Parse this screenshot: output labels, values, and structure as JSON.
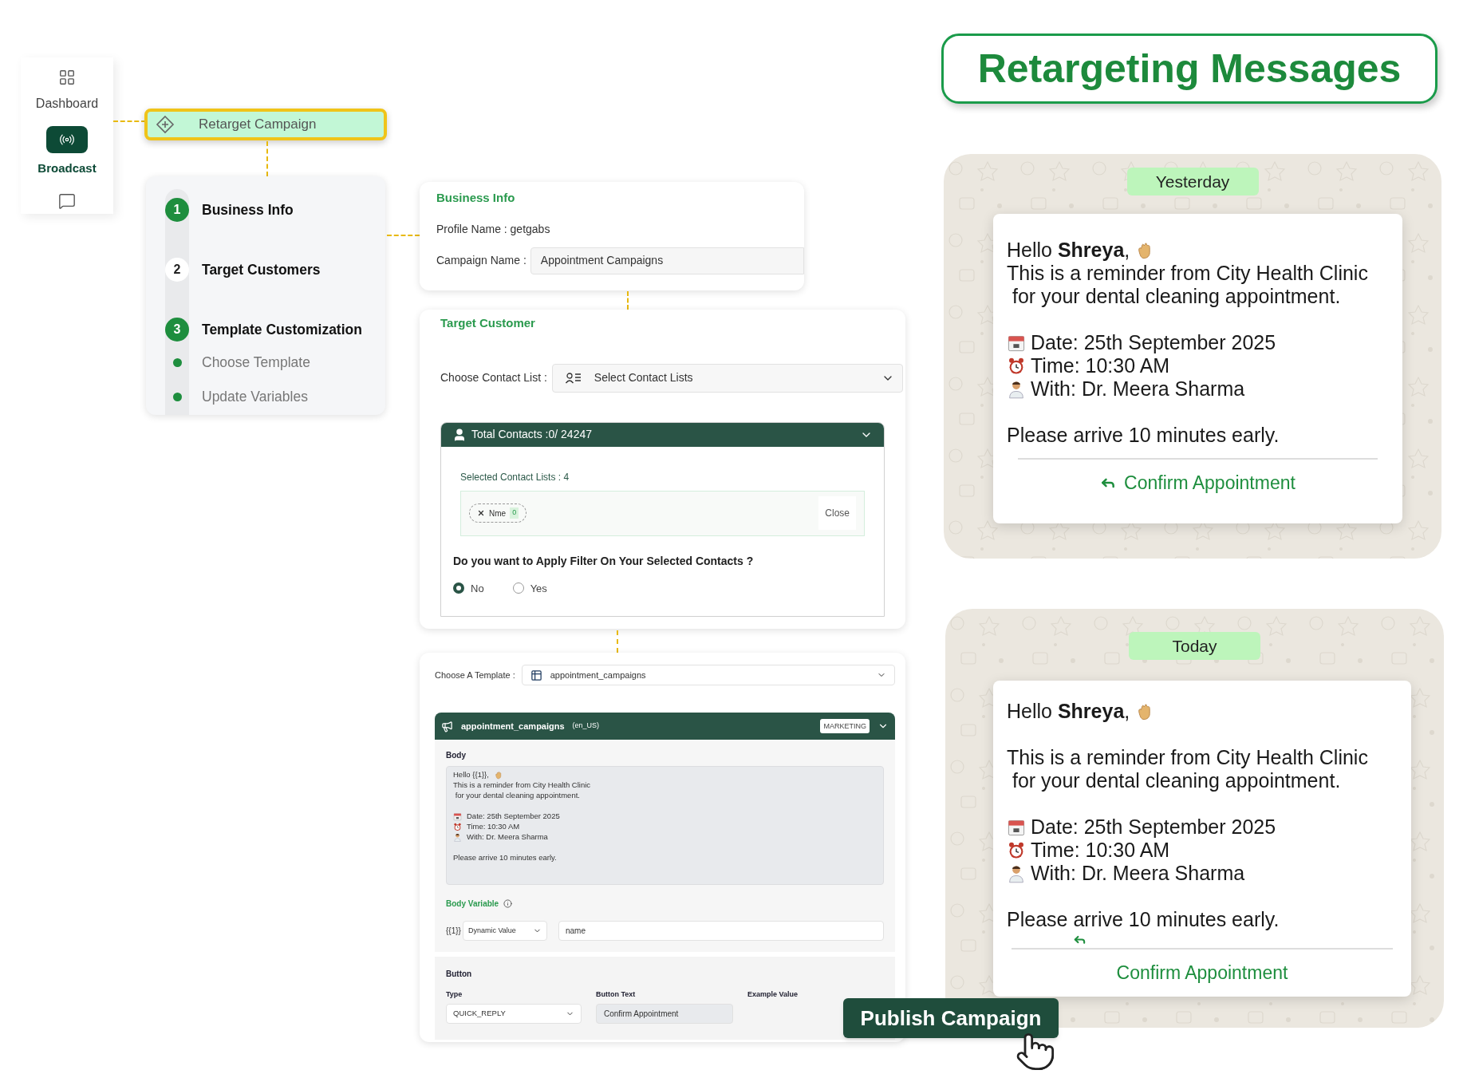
{
  "sidebar": {
    "items": [
      {
        "label": "Dashboard",
        "selected": false
      },
      {
        "label": "Broadcast",
        "selected": true
      },
      {
        "selected": false
      }
    ]
  },
  "flow_node": {
    "label": "Retarget Campaign"
  },
  "stepper": {
    "steps": [
      {
        "number": "1",
        "label": "Business Info",
        "completed": true
      },
      {
        "number": "2",
        "label": "Target Customers",
        "completed": false
      },
      {
        "number": "3",
        "label": "Template Customization",
        "completed": true,
        "children": [
          {
            "label": "Choose Template"
          },
          {
            "label": "Update Variables"
          }
        ]
      }
    ]
  },
  "business_info": {
    "title": "Business Info",
    "profile": "Profile Name : getgabs",
    "campaign_label": "Campaign Name :",
    "campaign_value": "Appointment Campaigns"
  },
  "target_customer": {
    "title": "Target Customer",
    "contact_list_label": "Choose Contact List :",
    "contact_list_placeholder": "Select Contact Lists",
    "total_contacts": "Total Contacts :0/ 24247",
    "expanded": true,
    "selected_count": "Selected Contact Lists : 4",
    "chips": [
      {
        "label": "Nme",
        "count": "0"
      }
    ],
    "close": "Close",
    "filter_question": "Do you want to Apply Filter On Your Selected Contacts ?",
    "options": [
      {
        "label": "No",
        "selected": true
      },
      {
        "label": "Yes",
        "selected": false
      }
    ]
  },
  "template": {
    "choose_label": "Choose A Template :",
    "choose_value": "appointment_campaigns",
    "name": "appointment_campaigns",
    "locale": "(en_US)",
    "category": "MARKETING",
    "body_label": "Body",
    "body_lines": [
      {
        "kind": "greeting",
        "text": "Hello {{1}},"
      },
      {
        "kind": "text",
        "text": "This is a reminder from City Health Clinic"
      },
      {
        "kind": "text",
        "text": " for your dental cleaning appointment."
      },
      {
        "kind": "gap"
      },
      {
        "kind": "date",
        "text": "Date: 25th September 2025"
      },
      {
        "kind": "time",
        "text": "Time: 10:30 AM"
      },
      {
        "kind": "host",
        "text": "With: Dr. Meera Sharma"
      },
      {
        "kind": "gap"
      },
      {
        "kind": "text",
        "text": "Please arrive 10 minutes early."
      }
    ],
    "variable_label": "Body Variable",
    "variable_token": "{{1}}",
    "variable_source": "Dynamic Value",
    "variable_value": "name",
    "button_title": "Button",
    "button_columns": [
      "Type",
      "Button Text",
      "Example Value"
    ],
    "button_type": "QUICK_REPLY",
    "button_text": "Confirm Appointment"
  },
  "publish_button": "Publish Campaign",
  "title": "Retargeting Messages",
  "chats": [
    {
      "day": "Yesterday",
      "kind": "inline",
      "reply_button": "Confirm Appointment",
      "lines": [
        {
          "kind": "greeting",
          "text": "Hello **Shreya**,"
        },
        {
          "kind": "text",
          "text": "This is a reminder from City Health Clinic"
        },
        {
          "kind": "text",
          "text": " for your dental cleaning appointment."
        },
        {
          "kind": "gap"
        },
        {
          "kind": "date",
          "text": "Date: 25th September 2025"
        },
        {
          "kind": "time",
          "text": "Time: 10:30 AM"
        },
        {
          "kind": "host",
          "text": "With: Dr. Meera Sharma"
        },
        {
          "kind": "gap"
        },
        {
          "kind": "text",
          "text": "Please arrive 10 minutes early."
        }
      ]
    },
    {
      "day": "Today",
      "kind": "stacked",
      "reply_button": "Confirm Appointment",
      "lines": [
        {
          "kind": "greeting",
          "text": "Hello **Shreya**,"
        },
        {
          "kind": "gap"
        },
        {
          "kind": "text",
          "text": "This is a reminder from City Health Clinic"
        },
        {
          "kind": "text",
          "text": " for your dental cleaning appointment."
        },
        {
          "kind": "gap"
        },
        {
          "kind": "date",
          "text": "Date: 25th September 2025"
        },
        {
          "kind": "time",
          "text": "Time: 10:30 AM"
        },
        {
          "kind": "host",
          "text": "With: Dr. Meera Sharma"
        },
        {
          "kind": "gap"
        },
        {
          "kind": "text",
          "text": "Please arrive 10 minutes early."
        }
      ]
    }
  ]
}
